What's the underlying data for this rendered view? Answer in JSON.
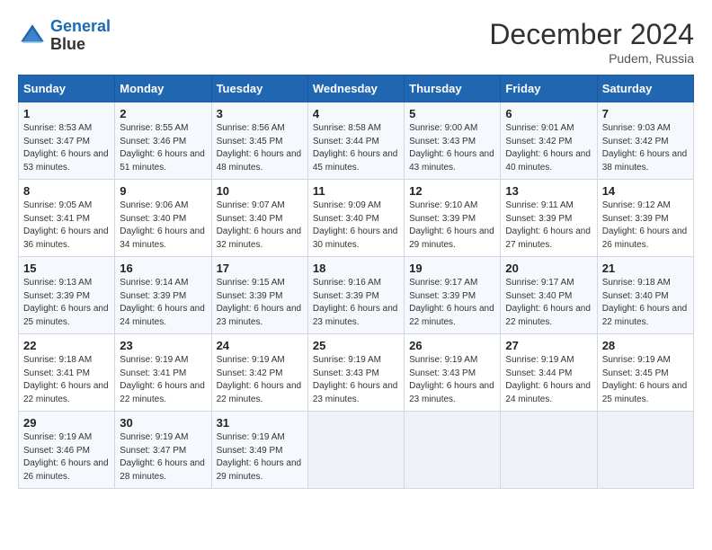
{
  "header": {
    "logo_line1": "General",
    "logo_line2": "Blue",
    "month": "December 2024",
    "location": "Pudem, Russia"
  },
  "days_of_week": [
    "Sunday",
    "Monday",
    "Tuesday",
    "Wednesday",
    "Thursday",
    "Friday",
    "Saturday"
  ],
  "weeks": [
    [
      {
        "day": "1",
        "sunrise": "Sunrise: 8:53 AM",
        "sunset": "Sunset: 3:47 PM",
        "daylight": "Daylight: 6 hours and 53 minutes."
      },
      {
        "day": "2",
        "sunrise": "Sunrise: 8:55 AM",
        "sunset": "Sunset: 3:46 PM",
        "daylight": "Daylight: 6 hours and 51 minutes."
      },
      {
        "day": "3",
        "sunrise": "Sunrise: 8:56 AM",
        "sunset": "Sunset: 3:45 PM",
        "daylight": "Daylight: 6 hours and 48 minutes."
      },
      {
        "day": "4",
        "sunrise": "Sunrise: 8:58 AM",
        "sunset": "Sunset: 3:44 PM",
        "daylight": "Daylight: 6 hours and 45 minutes."
      },
      {
        "day": "5",
        "sunrise": "Sunrise: 9:00 AM",
        "sunset": "Sunset: 3:43 PM",
        "daylight": "Daylight: 6 hours and 43 minutes."
      },
      {
        "day": "6",
        "sunrise": "Sunrise: 9:01 AM",
        "sunset": "Sunset: 3:42 PM",
        "daylight": "Daylight: 6 hours and 40 minutes."
      },
      {
        "day": "7",
        "sunrise": "Sunrise: 9:03 AM",
        "sunset": "Sunset: 3:42 PM",
        "daylight": "Daylight: 6 hours and 38 minutes."
      }
    ],
    [
      {
        "day": "8",
        "sunrise": "Sunrise: 9:05 AM",
        "sunset": "Sunset: 3:41 PM",
        "daylight": "Daylight: 6 hours and 36 minutes."
      },
      {
        "day": "9",
        "sunrise": "Sunrise: 9:06 AM",
        "sunset": "Sunset: 3:40 PM",
        "daylight": "Daylight: 6 hours and 34 minutes."
      },
      {
        "day": "10",
        "sunrise": "Sunrise: 9:07 AM",
        "sunset": "Sunset: 3:40 PM",
        "daylight": "Daylight: 6 hours and 32 minutes."
      },
      {
        "day": "11",
        "sunrise": "Sunrise: 9:09 AM",
        "sunset": "Sunset: 3:40 PM",
        "daylight": "Daylight: 6 hours and 30 minutes."
      },
      {
        "day": "12",
        "sunrise": "Sunrise: 9:10 AM",
        "sunset": "Sunset: 3:39 PM",
        "daylight": "Daylight: 6 hours and 29 minutes."
      },
      {
        "day": "13",
        "sunrise": "Sunrise: 9:11 AM",
        "sunset": "Sunset: 3:39 PM",
        "daylight": "Daylight: 6 hours and 27 minutes."
      },
      {
        "day": "14",
        "sunrise": "Sunrise: 9:12 AM",
        "sunset": "Sunset: 3:39 PM",
        "daylight": "Daylight: 6 hours and 26 minutes."
      }
    ],
    [
      {
        "day": "15",
        "sunrise": "Sunrise: 9:13 AM",
        "sunset": "Sunset: 3:39 PM",
        "daylight": "Daylight: 6 hours and 25 minutes."
      },
      {
        "day": "16",
        "sunrise": "Sunrise: 9:14 AM",
        "sunset": "Sunset: 3:39 PM",
        "daylight": "Daylight: 6 hours and 24 minutes."
      },
      {
        "day": "17",
        "sunrise": "Sunrise: 9:15 AM",
        "sunset": "Sunset: 3:39 PM",
        "daylight": "Daylight: 6 hours and 23 minutes."
      },
      {
        "day": "18",
        "sunrise": "Sunrise: 9:16 AM",
        "sunset": "Sunset: 3:39 PM",
        "daylight": "Daylight: 6 hours and 23 minutes."
      },
      {
        "day": "19",
        "sunrise": "Sunrise: 9:17 AM",
        "sunset": "Sunset: 3:39 PM",
        "daylight": "Daylight: 6 hours and 22 minutes."
      },
      {
        "day": "20",
        "sunrise": "Sunrise: 9:17 AM",
        "sunset": "Sunset: 3:40 PM",
        "daylight": "Daylight: 6 hours and 22 minutes."
      },
      {
        "day": "21",
        "sunrise": "Sunrise: 9:18 AM",
        "sunset": "Sunset: 3:40 PM",
        "daylight": "Daylight: 6 hours and 22 minutes."
      }
    ],
    [
      {
        "day": "22",
        "sunrise": "Sunrise: 9:18 AM",
        "sunset": "Sunset: 3:41 PM",
        "daylight": "Daylight: 6 hours and 22 minutes."
      },
      {
        "day": "23",
        "sunrise": "Sunrise: 9:19 AM",
        "sunset": "Sunset: 3:41 PM",
        "daylight": "Daylight: 6 hours and 22 minutes."
      },
      {
        "day": "24",
        "sunrise": "Sunrise: 9:19 AM",
        "sunset": "Sunset: 3:42 PM",
        "daylight": "Daylight: 6 hours and 22 minutes."
      },
      {
        "day": "25",
        "sunrise": "Sunrise: 9:19 AM",
        "sunset": "Sunset: 3:43 PM",
        "daylight": "Daylight: 6 hours and 23 minutes."
      },
      {
        "day": "26",
        "sunrise": "Sunrise: 9:19 AM",
        "sunset": "Sunset: 3:43 PM",
        "daylight": "Daylight: 6 hours and 23 minutes."
      },
      {
        "day": "27",
        "sunrise": "Sunrise: 9:19 AM",
        "sunset": "Sunset: 3:44 PM",
        "daylight": "Daylight: 6 hours and 24 minutes."
      },
      {
        "day": "28",
        "sunrise": "Sunrise: 9:19 AM",
        "sunset": "Sunset: 3:45 PM",
        "daylight": "Daylight: 6 hours and 25 minutes."
      }
    ],
    [
      {
        "day": "29",
        "sunrise": "Sunrise: 9:19 AM",
        "sunset": "Sunset: 3:46 PM",
        "daylight": "Daylight: 6 hours and 26 minutes."
      },
      {
        "day": "30",
        "sunrise": "Sunrise: 9:19 AM",
        "sunset": "Sunset: 3:47 PM",
        "daylight": "Daylight: 6 hours and 28 minutes."
      },
      {
        "day": "31",
        "sunrise": "Sunrise: 9:19 AM",
        "sunset": "Sunset: 3:49 PM",
        "daylight": "Daylight: 6 hours and 29 minutes."
      },
      null,
      null,
      null,
      null
    ]
  ]
}
